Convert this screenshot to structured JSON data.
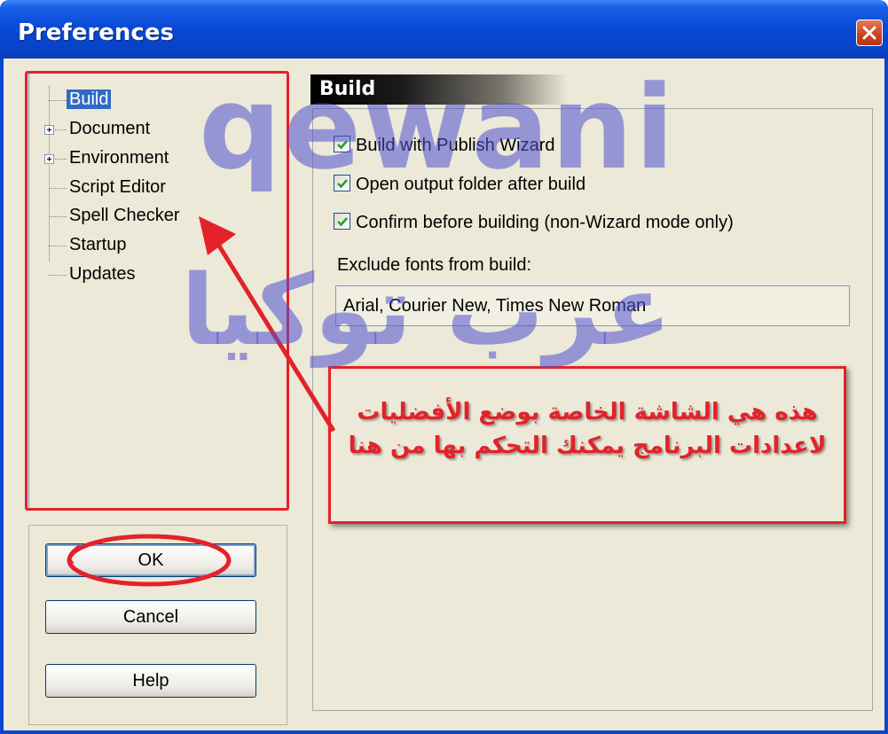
{
  "window": {
    "title": "Preferences"
  },
  "tree": {
    "items": [
      {
        "label": "Build",
        "selected": true,
        "expandable": false
      },
      {
        "label": "Document",
        "selected": false,
        "expandable": true
      },
      {
        "label": "Environment",
        "selected": false,
        "expandable": true
      },
      {
        "label": "Script Editor",
        "selected": false,
        "expandable": false
      },
      {
        "label": "Spell Checker",
        "selected": false,
        "expandable": false
      },
      {
        "label": "Startup",
        "selected": false,
        "expandable": false
      },
      {
        "label": "Updates",
        "selected": false,
        "expandable": false
      }
    ]
  },
  "buttons": {
    "ok": "OK",
    "cancel": "Cancel",
    "help": "Help"
  },
  "build": {
    "header": "Build",
    "options": [
      {
        "label": "Build with Publish Wizard",
        "checked": true
      },
      {
        "label": "Open output folder after build",
        "checked": true
      },
      {
        "label": "Confirm before building (non-Wizard mode only)",
        "checked": true
      }
    ],
    "exclude_label": "Exclude fonts from build:",
    "exclude_value": "Arial, Courier New, Times New Roman"
  },
  "annotation": {
    "line1": "هذه هي الشاشة الخاصة بوضع الأفضليات",
    "line2": "لاعدادات البرنامج يمكنك التحكم بها من هنا",
    "color": "#e3222a"
  },
  "watermark": {
    "latin": "qewani",
    "arabic": "عرب توكيا"
  },
  "colors": {
    "titlebar": "#0a4ad6",
    "selection": "#316ac5",
    "dialog_bg": "#ece9d8",
    "annotation_red": "#e3222a"
  }
}
